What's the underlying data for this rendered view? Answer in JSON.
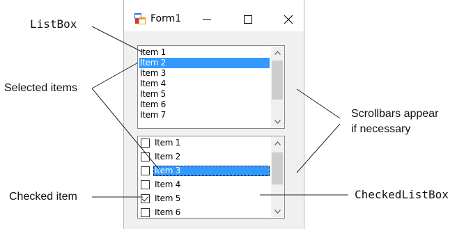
{
  "window": {
    "title": "Form1",
    "minimize_glyph": "—",
    "maximize_glyph": "☐",
    "close_glyph": "✕"
  },
  "listbox": {
    "items": [
      "Item 1",
      "Item 2",
      "Item 3",
      "Item 4",
      "Item 5",
      "Item 6",
      "Item 7"
    ],
    "selected_index": 1
  },
  "checked_listbox": {
    "items": [
      {
        "label": "Item 1",
        "checked": false,
        "selected": false
      },
      {
        "label": "Item 2",
        "checked": false,
        "selected": false
      },
      {
        "label": "Item 3",
        "checked": false,
        "selected": true
      },
      {
        "label": "Item 4",
        "checked": false,
        "selected": false
      },
      {
        "label": "Item 5",
        "checked": true,
        "selected": false
      },
      {
        "label": "Item 6",
        "checked": false,
        "selected": false
      }
    ]
  },
  "annotations": {
    "listbox": "ListBox",
    "selected_items": "Selected items",
    "scrollbars_line1": "Scrollbars appear",
    "scrollbars_line2": "if necessary",
    "checked_item": "Checked item",
    "checkedlistbox": "CheckedListBox"
  },
  "colors": {
    "selection": "#3399ff",
    "window_bg": "#f0f0f0",
    "scroll_thumb": "#cdcdcd"
  },
  "icons": {
    "app": "form-app-icon",
    "scroll_up": "chevron-up-icon",
    "scroll_down": "chevron-down-icon"
  }
}
